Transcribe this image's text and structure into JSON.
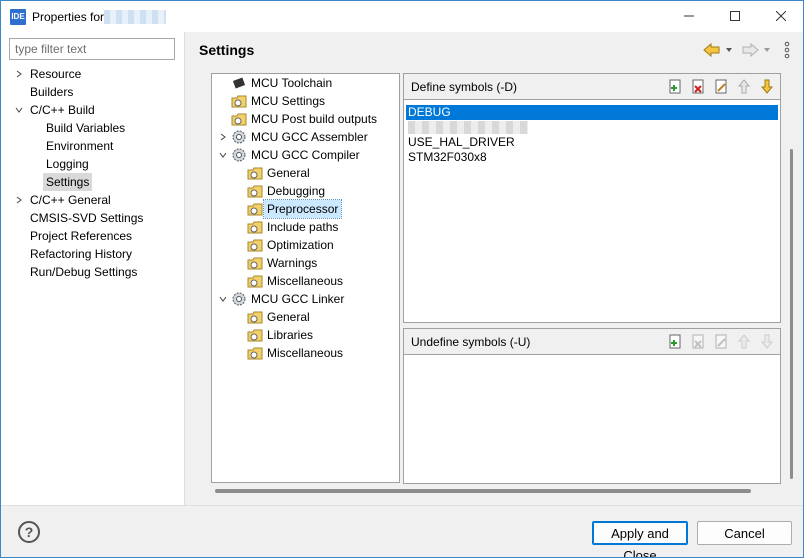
{
  "window": {
    "title": "Properties for",
    "controls": {
      "minimize": "minimize-icon",
      "maximize": "maximize-icon",
      "close": "close-icon"
    }
  },
  "nav": {
    "filter_placeholder": "type filter text",
    "items": [
      {
        "label": "Resource",
        "expandable": true,
        "expanded": false
      },
      {
        "label": "Builders"
      },
      {
        "label": "C/C++ Build",
        "expandable": true,
        "expanded": true
      },
      {
        "label": "Build Variables"
      },
      {
        "label": "Environment"
      },
      {
        "label": "Logging"
      },
      {
        "label": "Settings",
        "selected": true
      },
      {
        "label": "C/C++ General",
        "expandable": true,
        "expanded": false
      },
      {
        "label": "CMSIS-SVD Settings"
      },
      {
        "label": "Project References"
      },
      {
        "label": "Refactoring History"
      },
      {
        "label": "Run/Debug Settings"
      }
    ]
  },
  "main": {
    "title": "Settings"
  },
  "tool_tree": [
    {
      "label": "MCU Toolchain"
    },
    {
      "label": "MCU Settings"
    },
    {
      "label": "MCU Post build outputs"
    },
    {
      "label": "MCU GCC Assembler",
      "expandable": true,
      "expanded": false
    },
    {
      "label": "MCU GCC Compiler",
      "expandable": true,
      "expanded": true
    },
    {
      "label": "General"
    },
    {
      "label": "Debugging"
    },
    {
      "label": "Preprocessor",
      "selected": true
    },
    {
      "label": "Include paths"
    },
    {
      "label": "Optimization"
    },
    {
      "label": "Warnings"
    },
    {
      "label": "Miscellaneous"
    },
    {
      "label": "MCU GCC Linker",
      "expandable": true,
      "expanded": true
    },
    {
      "label": "General"
    },
    {
      "label": "Libraries"
    },
    {
      "label": "Miscellaneous"
    }
  ],
  "define_panel": {
    "title": "Define symbols (-D)",
    "symbols": [
      "DEBUG",
      "",
      "USE_HAL_DRIVER",
      "STM32F030x8"
    ],
    "selected_index": 0
  },
  "undefine_panel": {
    "title": "Undefine symbols (-U)",
    "symbols": []
  },
  "footer": {
    "apply_label": "Apply and Close",
    "cancel_label": "Cancel",
    "help_glyph": "?"
  },
  "colors": {
    "selection": "#0078d7",
    "tree_selection": "#cce8ff",
    "window_border": "#3b87c8"
  }
}
